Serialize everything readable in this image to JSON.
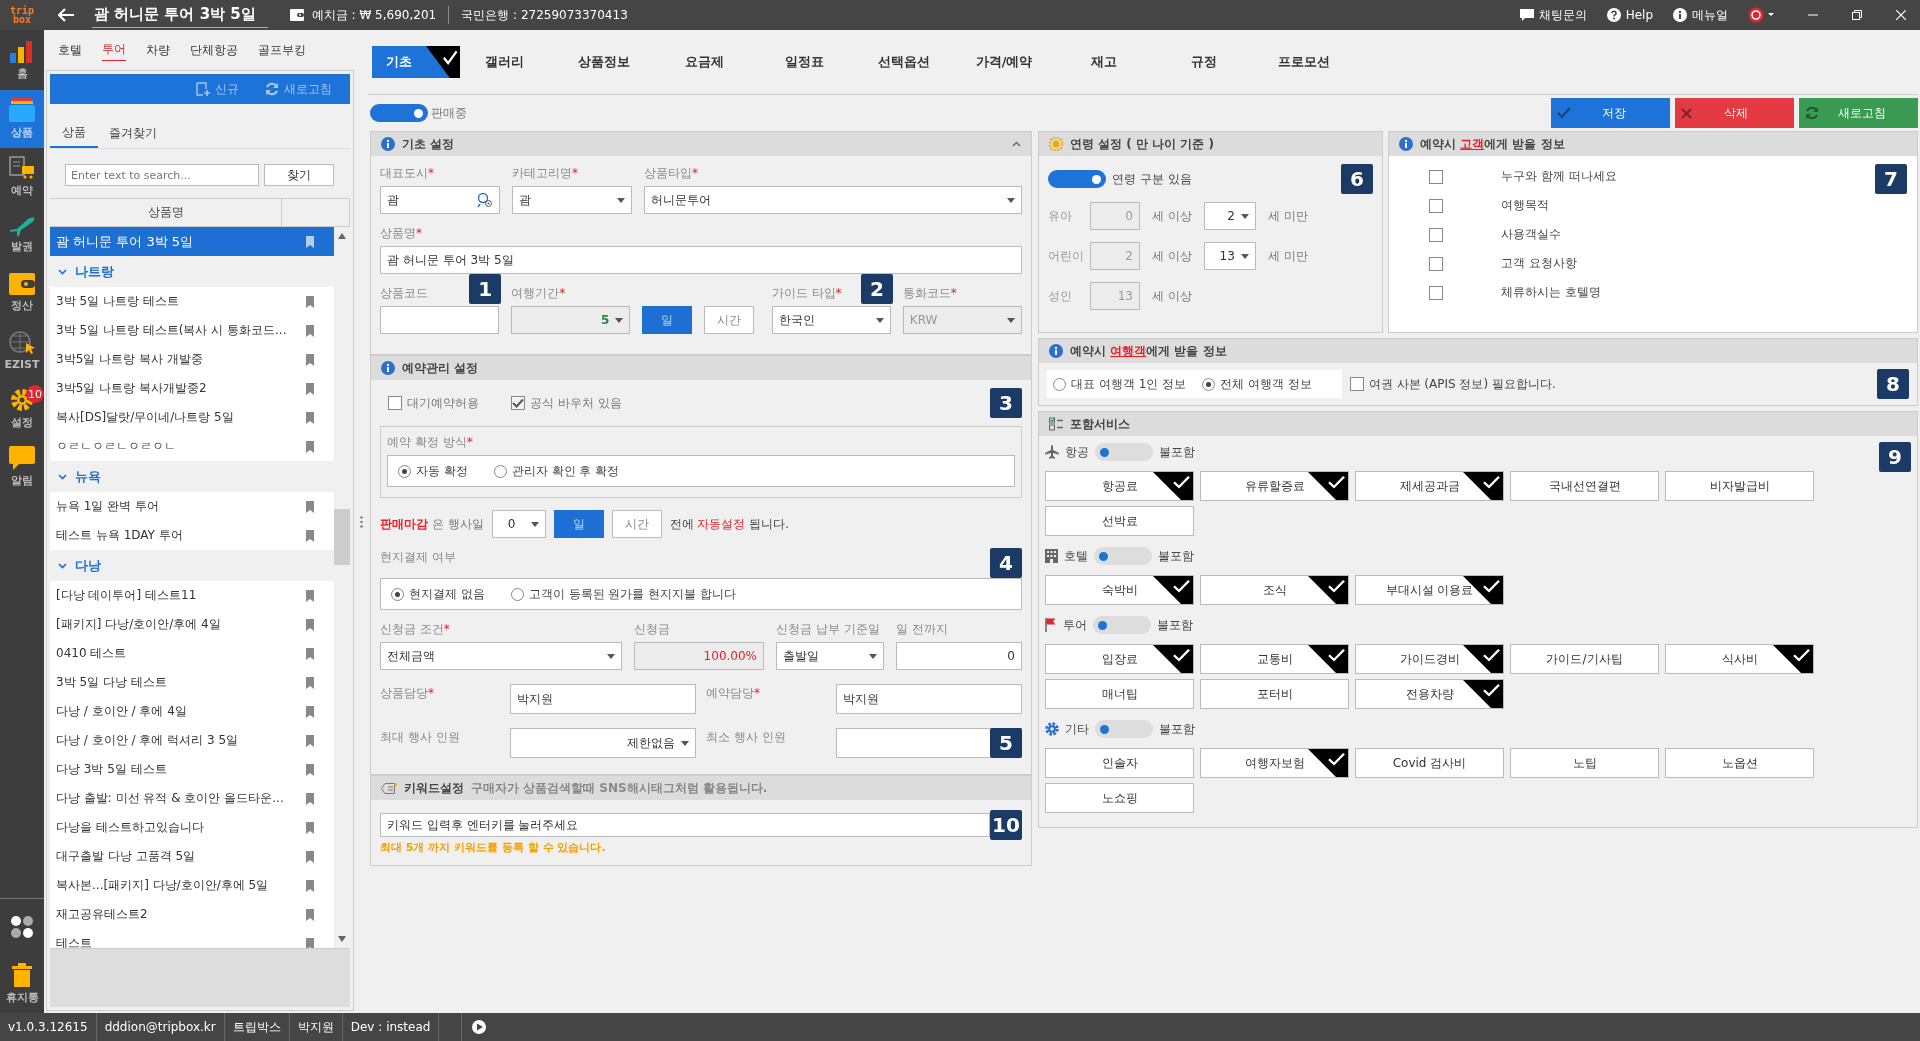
{
  "title_bar": {
    "logo": [
      "trip",
      "box"
    ],
    "title": "괌 허니문 투어 3박 5일",
    "deposit": "예치금 : ₩ 5,690,201",
    "bank": "국민은행 : 27259073370413",
    "links": [
      {
        "kind": "chat",
        "label": "채팅문의"
      },
      {
        "kind": "help",
        "label": "Help"
      },
      {
        "kind": "info",
        "label": "메뉴얼"
      }
    ]
  },
  "nav": [
    {
      "kind": "home",
      "label": "홈",
      "selected": false
    },
    {
      "kind": "product",
      "label": "상품",
      "selected": true
    },
    {
      "kind": "booking",
      "label": "예약",
      "selected": false
    },
    {
      "kind": "ticket",
      "label": "발권",
      "selected": false
    },
    {
      "kind": "wallet",
      "label": "정산",
      "selected": false
    },
    {
      "kind": "globe",
      "label": "EZIST",
      "selected": false
    },
    {
      "kind": "settings",
      "label": "설정",
      "selected": false,
      "badge": "10"
    },
    {
      "kind": "alert",
      "label": "알림",
      "selected": false
    }
  ],
  "nav_bottom": [
    {
      "kind": "apps"
    },
    {
      "kind": "trash",
      "label": "휴지통"
    }
  ],
  "category_tabs": [
    {
      "label": "호텔",
      "selected": false
    },
    {
      "label": "투어",
      "selected": true
    },
    {
      "label": "차량",
      "selected": false
    },
    {
      "label": "단체항공",
      "selected": false
    },
    {
      "label": "골프부킹",
      "selected": false
    }
  ],
  "list_toolbar": {
    "new": "신규",
    "refresh": "새로고침"
  },
  "list_tabs": [
    {
      "label": "상품",
      "selected": true
    },
    {
      "label": "즐겨찾기",
      "selected": false
    }
  ],
  "search": {
    "placeholder": "Enter text to search...",
    "button": "찾기"
  },
  "product_list": {
    "header": "상품명",
    "items": [
      {
        "label": "괌 허니문 투어 3박 5일",
        "selected": true
      },
      {
        "label": "나트랑",
        "expanded": true,
        "children": [
          {
            "label": "3박 5일 나트랑 테스트",
            "selected": false
          },
          {
            "label": "3박 5일 나트랑 테스트(복사 시 통화코드...",
            "selected": false
          },
          {
            "label": "3박5일 나트랑 복사 개발중",
            "selected": false
          },
          {
            "label": "3박5일 나트랑 복사개발중2",
            "selected": false
          },
          {
            "label": "복사[DS]달랏/무이네/나트랑 5일",
            "selected": false
          },
          {
            "label": "ㅇㄹㄴㅇㄹㄴㅇㄹㅇㄴ",
            "selected": false
          }
        ]
      },
      {
        "label": "뉴욕",
        "expanded": true,
        "children": [
          {
            "label": "뉴욕 1일 완벽 투어",
            "selected": false
          },
          {
            "label": "테스트 뉴욕 1DAY 투어",
            "selected": false
          }
        ]
      },
      {
        "label": "다낭",
        "expanded": true,
        "children": [
          {
            "label": "[다낭 데이투어] 테스트11",
            "selected": false
          },
          {
            "label": "[패키지] 다낭/호이안/후에 4일",
            "selected": false
          },
          {
            "label": "0410 테스트",
            "selected": false
          },
          {
            "label": "3박 5일 다낭 테스트",
            "selected": false
          },
          {
            "label": "다낭 / 호이안 / 후에  4일",
            "selected": false
          },
          {
            "label": "다낭 / 호이안 / 후에 럭셔리 3  5일",
            "selected": false
          },
          {
            "label": "다낭 3박 5일 테스트",
            "selected": false
          },
          {
            "label": "다낭 출발: 미선 유적 & 호이안 올드타운...",
            "selected": false
          },
          {
            "label": "다낭을 테스트하고있습니다",
            "selected": false
          },
          {
            "label": "대구출발 다낭 고품격 5일",
            "selected": false
          },
          {
            "label": "복사본...[패키지] 다낭/호이안/후에 5일",
            "selected": false
          },
          {
            "label": "재고공유테스트2",
            "selected": false
          },
          {
            "label": "테스트",
            "selected": false
          }
        ]
      }
    ]
  },
  "status_bar": [
    "v1.0.3.12615",
    "dddion@tripbox.kr",
    "트립박스",
    "박지원",
    "Dev : instead"
  ],
  "main_tabs": [
    {
      "label": "기초",
      "selected": true
    },
    {
      "label": "갤러리",
      "selected": false
    },
    {
      "label": "상품정보",
      "selected": false
    },
    {
      "label": "요금제",
      "selected": false
    },
    {
      "label": "일정표",
      "selected": false
    },
    {
      "label": "선택옵션",
      "selected": false
    },
    {
      "label": "가격/예약",
      "selected": false
    },
    {
      "label": "재고",
      "selected": false
    },
    {
      "label": "규정",
      "selected": false
    },
    {
      "label": "프로모션",
      "selected": false
    }
  ],
  "sale_toggle": {
    "label": "판매중",
    "on": true
  },
  "actions": [
    {
      "kind": "save",
      "label": "저장"
    },
    {
      "kind": "delete",
      "label": "삭제"
    },
    {
      "kind": "refresh",
      "label": "새로고침"
    }
  ],
  "basic": {
    "title": "기초 설정",
    "city": {
      "label": "대표도시",
      "required_mark": "*",
      "value": "괌"
    },
    "category": {
      "label": "카테고리명",
      "required_mark": "*",
      "value": "괌"
    },
    "type": {
      "label": "상품타입",
      "required_mark": "*",
      "value": "허니문투어"
    },
    "name": {
      "label": "상품명",
      "required_mark": "*",
      "value": "괌 허니문 투어 3박 5일"
    },
    "code": {
      "label": "상품코드",
      "marker": "1"
    },
    "duration": {
      "label": "여행기간",
      "required_mark": "*",
      "value": "5",
      "units": [
        {
          "label": "일",
          "selected": true
        },
        {
          "label": "시간",
          "selected": false
        }
      ]
    },
    "guide": {
      "label": "가이드 타입",
      "required_mark": "*",
      "value": "한국인",
      "marker": "2"
    },
    "currency": {
      "label": "통화코드",
      "required_mark": "*",
      "value": "KRW",
      "disabled": true
    }
  },
  "booking": {
    "title": "예약관리 설정",
    "marker": "3",
    "options": [
      {
        "label": "대기예약허용",
        "checked": false
      },
      {
        "label": "공식 바우처 있음",
        "checked": true
      }
    ],
    "confirm": {
      "label": "예약 확정 방식",
      "required_mark": "*",
      "choices": [
        {
          "label": "자동 확정",
          "selected": true
        },
        {
          "label": "관리자 확인 후 확정",
          "selected": false
        }
      ]
    },
    "deadline": {
      "highlight": "판매마감",
      "text": "은 행사일",
      "value": "0",
      "units": [
        {
          "label": "일",
          "selected": true
        },
        {
          "label": "시간",
          "selected": false
        }
      ],
      "before": "전에",
      "auto": "자동설정",
      "after": "됩니다."
    },
    "local_payment": {
      "label": "현지결제 여부",
      "marker": "4",
      "choices": [
        {
          "label": "현지결제 없음",
          "selected": true
        },
        {
          "label": "고객이 등록된 원가를 현지지불 합니다",
          "selected": false
        }
      ]
    },
    "deposit_condition": {
      "label": "신청금 조건",
      "required_mark": "*",
      "value": "전체금액"
    },
    "deposit_amount": {
      "label": "신청금",
      "value": "100.00%"
    },
    "deposit_due": {
      "label": "신청금 납부 기준일",
      "value": "출발일"
    },
    "deposit_days": {
      "label": "일 전까지",
      "value": "0"
    },
    "managers": [
      {
        "label": "상품담당",
        "required_mark": "*",
        "value": "박지원"
      },
      {
        "label": "예약담당",
        "required_mark": "*",
        "value": "박지원"
      }
    ],
    "max_people": {
      "label": "최대 행사 인원",
      "value": "제한없음"
    },
    "min_people": {
      "label": "최소 행사 인원",
      "marker": "5"
    }
  },
  "keyword": {
    "title": "키워드설정",
    "hint": "구매자가 상품검색할때  SNS해시태그처럼 활용됩니다.",
    "placeholder": "키워드 입력후 엔터키를 눌러주세요",
    "marker": "10",
    "note": "최대 5개 까지 키워드를 등록 할 수 있습니다."
  },
  "age": {
    "title": "연령 설정 ( 만 나이 기준 )",
    "marker": "6",
    "toggle": {
      "label": "연령 구분 있음",
      "on": true
    },
    "rows": [
      {
        "label": "유아",
        "from": "0",
        "from_unit": "세 이상",
        "to": "2",
        "to_unit": "세 미만"
      },
      {
        "label": "어린이",
        "from": "2",
        "from_unit": "세 이상",
        "to": "13",
        "to_unit": "세 미만"
      },
      {
        "label": "성인",
        "from": "13",
        "from_unit": "세 이상"
      }
    ]
  },
  "customer_info": {
    "title": {
      "before": "예약시",
      "highlight": "고객",
      "after": "에게 받을 정보"
    },
    "marker": "7",
    "items": [
      {
        "label": "누구와 함께 떠나세요",
        "checked": false
      },
      {
        "label": "여행목적",
        "checked": false
      },
      {
        "label": "사용객실수",
        "checked": false
      },
      {
        "label": "고객 요청사항",
        "checked": false
      },
      {
        "label": "체류하시는 호텔명",
        "checked": false
      }
    ]
  },
  "traveler_info": {
    "title": {
      "before": "예약시",
      "highlight": "여행객",
      "after": "에게 받을 정보"
    },
    "marker": "8",
    "choices": [
      {
        "label": "대표 여행객 1인 정보",
        "selected": false
      },
      {
        "label": "전체 여행객 정보",
        "selected": true
      }
    ],
    "passport": {
      "label": "여권 사본 (APIS 정보) 필요합니다.",
      "checked": false
    }
  },
  "services": {
    "title": "포함서비스",
    "marker": "9",
    "groups": [
      {
        "kind": "flight",
        "label": "항공",
        "toggle": {
          "label": "불포함",
          "on": false
        },
        "items": [
          {
            "label": "항공료",
            "checked": true
          },
          {
            "label": "유류할증료",
            "checked": true
          },
          {
            "label": "제세공과금",
            "checked": true
          },
          {
            "label": "국내선연결편",
            "checked": false
          },
          {
            "label": "비자발급비",
            "checked": false
          },
          {
            "label": "선박료",
            "checked": false
          }
        ]
      },
      {
        "kind": "hotel",
        "label": "호텔",
        "toggle": {
          "label": "불포함",
          "on": false
        },
        "items": [
          {
            "label": "숙박비",
            "checked": true
          },
          {
            "label": "조식",
            "checked": true
          },
          {
            "label": "부대시설 이용료",
            "checked": true
          }
        ]
      },
      {
        "kind": "tour",
        "label": "투어",
        "toggle": {
          "label": "불포함",
          "on": false
        },
        "items": [
          {
            "label": "입장료",
            "checked": true
          },
          {
            "label": "교통비",
            "checked": true
          },
          {
            "label": "가이드경비",
            "checked": true
          },
          {
            "label": "가이드/기사팁",
            "checked": false
          },
          {
            "label": "식사비",
            "checked": true
          },
          {
            "label": "매너팁",
            "checked": false
          },
          {
            "label": "포터비",
            "checked": false
          },
          {
            "label": "전용차량",
            "checked": true
          }
        ]
      },
      {
        "kind": "etc",
        "label": "기타",
        "toggle": {
          "label": "불포함",
          "on": false
        },
        "items": [
          {
            "label": "인솔자",
            "checked": false
          },
          {
            "label": "여행자보험",
            "checked": true
          },
          {
            "label": "Covid 검사비",
            "checked": false
          },
          {
            "label": "노팁",
            "checked": false
          },
          {
            "label": "노옵션",
            "checked": false
          },
          {
            "label": "노쇼핑",
            "checked": false
          }
        ]
      }
    ]
  }
}
